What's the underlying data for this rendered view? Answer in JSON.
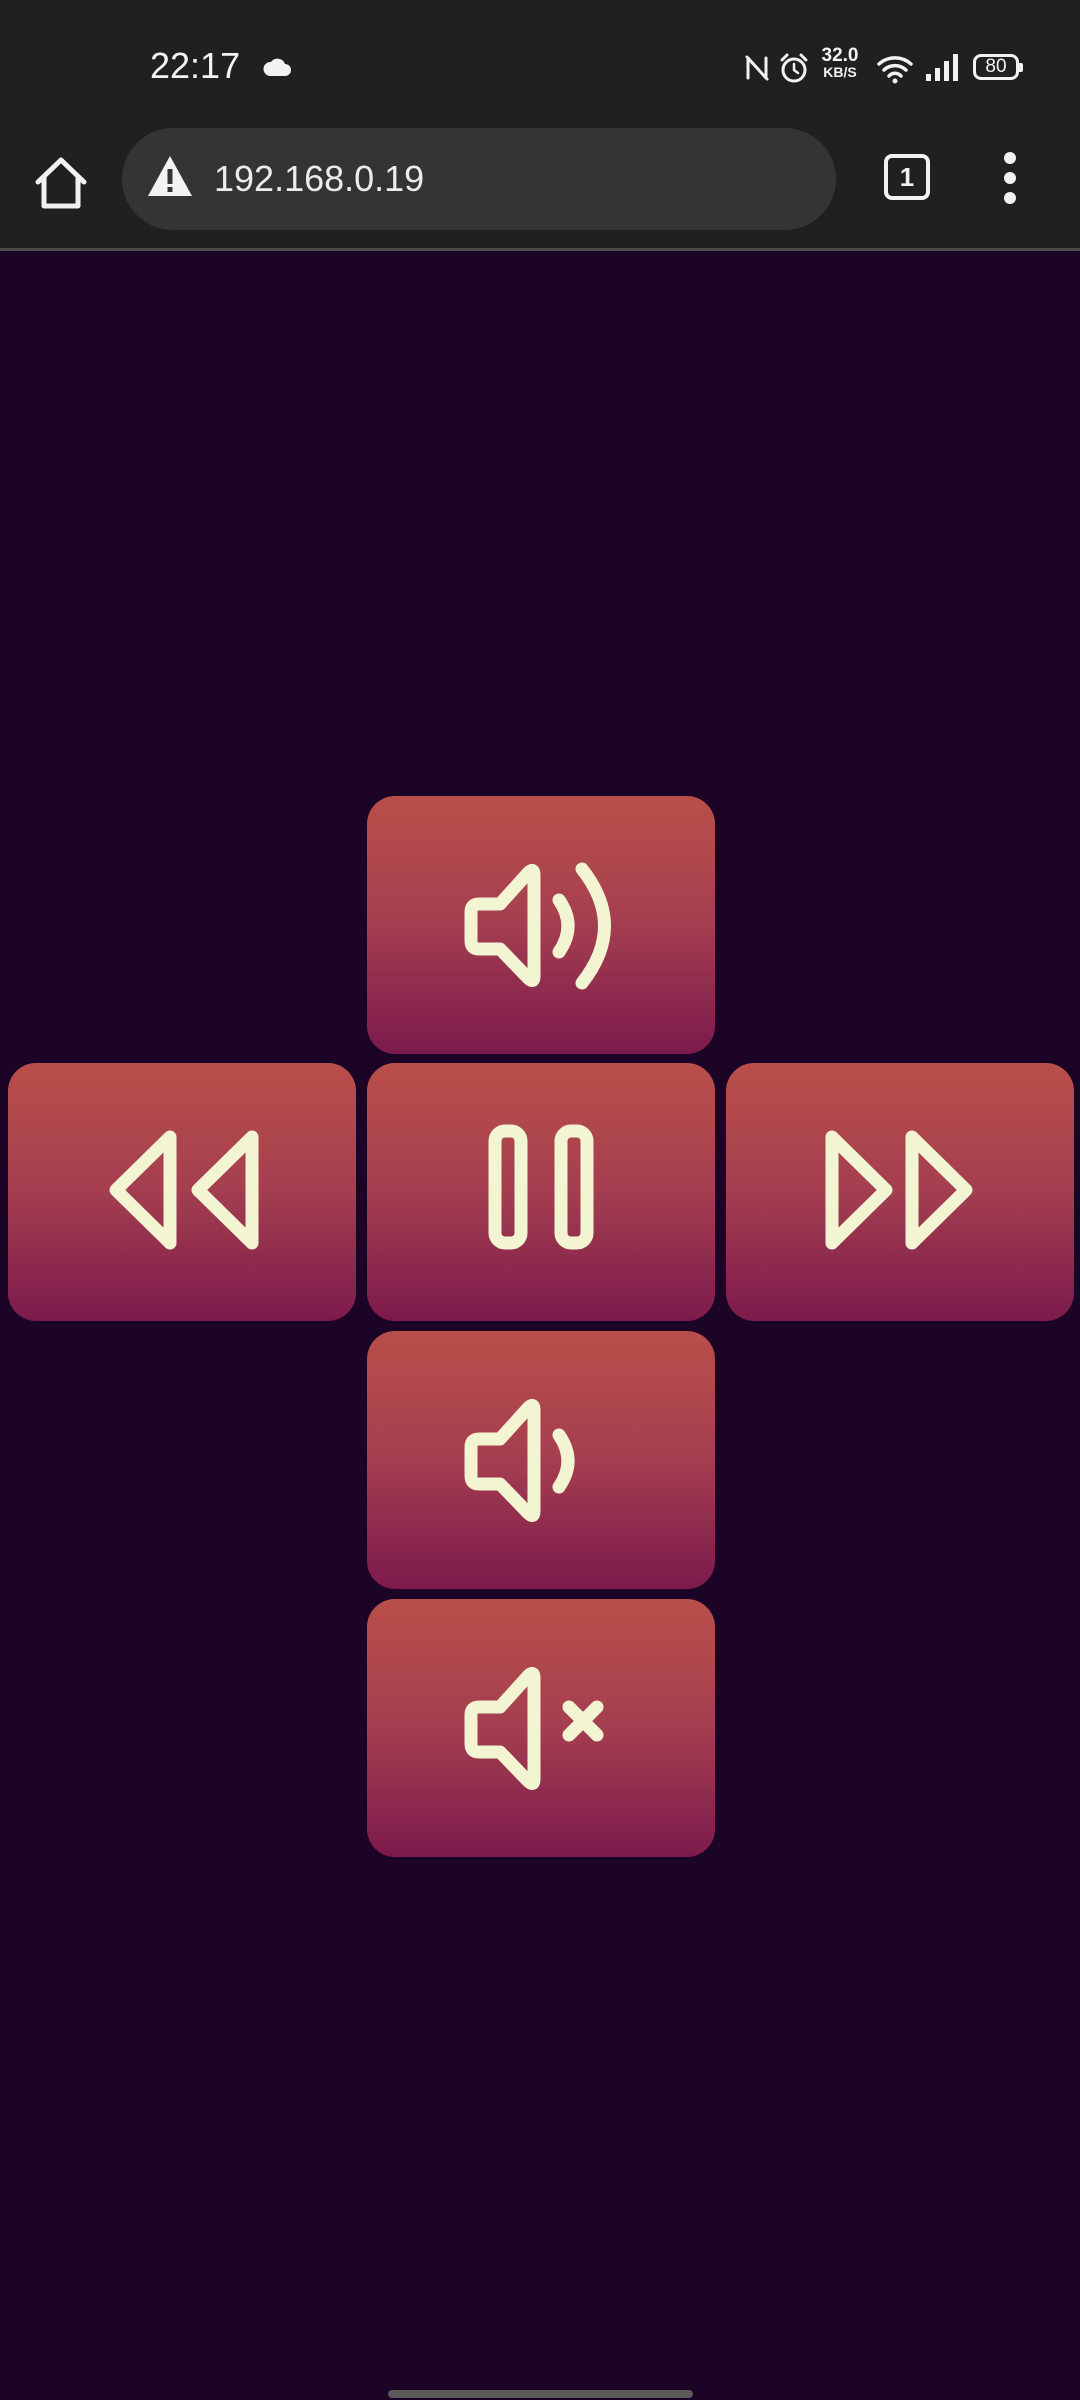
{
  "status_bar": {
    "time": "22:17",
    "net_speed_value": "32.0",
    "net_speed_unit": "KB/S",
    "battery": "80"
  },
  "browser": {
    "url": "192.168.0.19",
    "tab_count": "1"
  },
  "remote": {
    "icon_color": "#f3f4d2",
    "buttons": [
      "volume-up",
      "rewind",
      "pause",
      "fast-forward",
      "volume-down",
      "mute"
    ]
  },
  "colors": {
    "page_background": "#1c0426",
    "button_top": "#b94f49",
    "button_bottom": "#7c1a4c",
    "chrome_background": "#202020"
  }
}
